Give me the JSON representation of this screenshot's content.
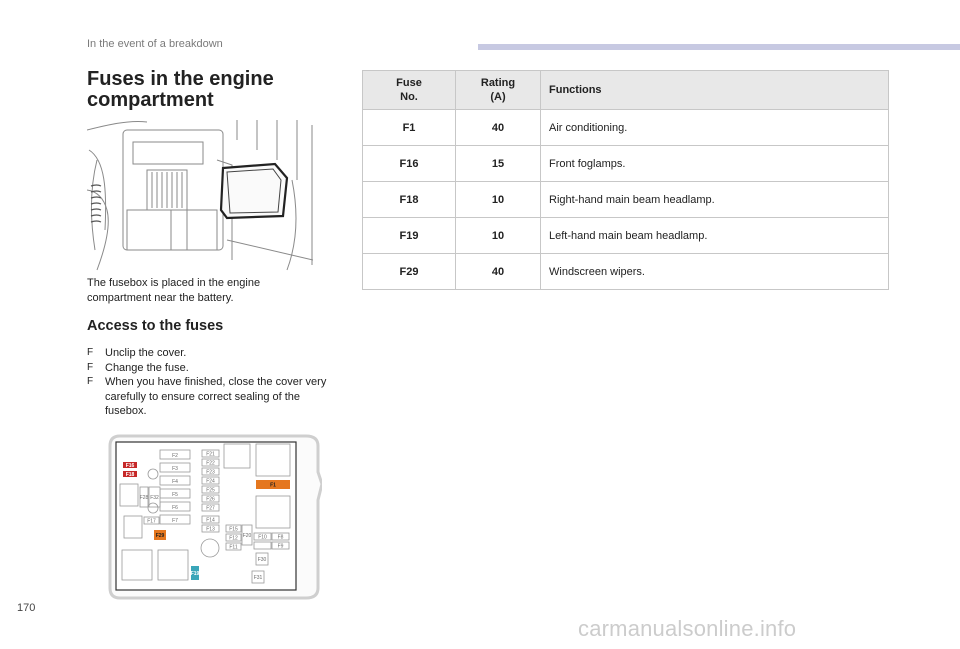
{
  "header": {
    "section": "In the event of a breakdown",
    "accent_color": "#c7c9e2"
  },
  "title": "Fuses in the engine compartment",
  "photo_description_icon": "engine-fusebox-photo",
  "intro": "The fusebox is placed in the engine compartment near the battery.",
  "access_heading": "Access to the fuses",
  "steps": [
    "Unclip the cover.",
    "Change the fuse.",
    "When you have finished, close the cover very carefully to ensure correct sealing of the fusebox."
  ],
  "step_bullet": "F",
  "diagram": {
    "labels": {
      "f2": "F2",
      "f3": "F3",
      "f4": "F4",
      "f5": "F5",
      "f6": "F6",
      "f7": "F7",
      "f21": "F21",
      "f22": "F22",
      "f23": "F23",
      "f24": "F24",
      "f25": "F25",
      "f26": "F26",
      "f27": "F27",
      "f17": "F17",
      "f14": "F14",
      "f13": "F13",
      "f15": "F15",
      "f12": "F12",
      "f11": "F11",
      "f20": "F20",
      "f10": "F10",
      "f8": "F8",
      "f9": "F9",
      "f30": "F30",
      "f31": "F31",
      "f32": "F32",
      "f1": "F1",
      "f29": "F29",
      "f16": "F16",
      "f18": "F18",
      "f19": "F19",
      "f28": "F28"
    },
    "highlight_colors": {
      "f1": "#e5771f",
      "f29": "#e5771f",
      "f16_18": "#c62828",
      "f19": "#3aa6b9"
    }
  },
  "table": {
    "headers": {
      "fuse_no_1": "Fuse",
      "fuse_no_2": "No.",
      "rating_1": "Rating",
      "rating_2": "(A)",
      "functions": "Functions"
    },
    "rows": [
      {
        "fuse": "F1",
        "rating": "40",
        "function": "Air conditioning."
      },
      {
        "fuse": "F16",
        "rating": "15",
        "function": "Front foglamps."
      },
      {
        "fuse": "F18",
        "rating": "10",
        "function": "Right-hand main beam headlamp."
      },
      {
        "fuse": "F19",
        "rating": "10",
        "function": "Left-hand main beam headlamp."
      },
      {
        "fuse": "F29",
        "rating": "40",
        "function": "Windscreen wipers."
      }
    ]
  },
  "page_number": "170",
  "watermark": "carmanualsonline.info"
}
